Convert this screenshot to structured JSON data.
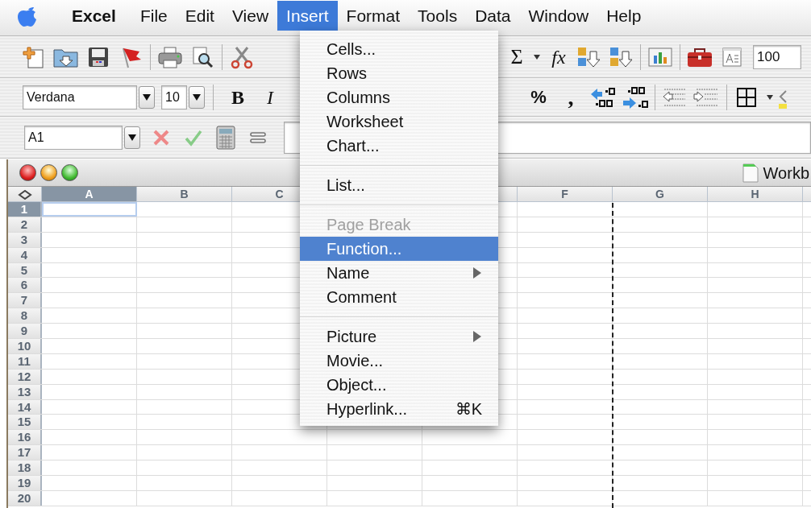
{
  "menubar": {
    "items": [
      {
        "label": "Excel",
        "kind": "app",
        "selected": false
      },
      {
        "label": "File",
        "kind": "menu",
        "selected": false
      },
      {
        "label": "Edit",
        "kind": "menu",
        "selected": false
      },
      {
        "label": "View",
        "kind": "menu",
        "selected": false
      },
      {
        "label": "Insert",
        "kind": "menu",
        "selected": true
      },
      {
        "label": "Format",
        "kind": "menu",
        "selected": false
      },
      {
        "label": "Tools",
        "kind": "menu",
        "selected": false
      },
      {
        "label": "Data",
        "kind": "menu",
        "selected": false
      },
      {
        "label": "Window",
        "kind": "menu",
        "selected": false
      },
      {
        "label": "Help",
        "kind": "menu",
        "selected": false
      }
    ]
  },
  "standard_toolbar": {
    "sum": "Σ",
    "function": "fx",
    "zoom": "100"
  },
  "formatting_toolbar": {
    "font": "Verdana",
    "size": "10",
    "bold": "B",
    "italic": "I",
    "percent": "%",
    "comma": ","
  },
  "formula_bar": {
    "name_box": "A1"
  },
  "workbook": {
    "title": "Workb",
    "columns_left": [
      {
        "label": "A",
        "selected": true,
        "page_break": false
      },
      {
        "label": "B",
        "selected": false,
        "page_break": false
      },
      {
        "label": "C",
        "selected": false,
        "page_break": false
      }
    ],
    "columns_right": [
      {
        "label": "F",
        "selected": false,
        "page_break": true
      },
      {
        "label": "G",
        "selected": false,
        "page_break": false
      },
      {
        "label": "H",
        "selected": false,
        "page_break": false
      }
    ],
    "rows": [
      {
        "label": "1",
        "selected": true
      },
      {
        "label": "2",
        "selected": false
      },
      {
        "label": "3",
        "selected": false
      },
      {
        "label": "4",
        "selected": false
      },
      {
        "label": "5",
        "selected": false
      },
      {
        "label": "6",
        "selected": false
      },
      {
        "label": "7",
        "selected": false
      },
      {
        "label": "8",
        "selected": false
      },
      {
        "label": "9",
        "selected": false
      },
      {
        "label": "10",
        "selected": false
      },
      {
        "label": "11",
        "selected": false
      },
      {
        "label": "12",
        "selected": false
      },
      {
        "label": "13",
        "selected": false
      },
      {
        "label": "14",
        "selected": false
      },
      {
        "label": "15",
        "selected": false
      },
      {
        "label": "16",
        "selected": false
      },
      {
        "label": "17",
        "selected": false
      },
      {
        "label": "18",
        "selected": false
      },
      {
        "label": "19",
        "selected": false
      },
      {
        "label": "20",
        "selected": false
      }
    ]
  },
  "insert_menu": {
    "items": [
      {
        "kind": "item",
        "label": "Cells...",
        "disabled": false,
        "selected": false
      },
      {
        "kind": "item",
        "label": "Rows",
        "disabled": false,
        "selected": false
      },
      {
        "kind": "item",
        "label": "Columns",
        "disabled": false,
        "selected": false
      },
      {
        "kind": "item",
        "label": "Worksheet",
        "disabled": false,
        "selected": false
      },
      {
        "kind": "item",
        "label": "Chart...",
        "disabled": false,
        "selected": false
      },
      {
        "kind": "separator"
      },
      {
        "kind": "item",
        "label": "List...",
        "disabled": false,
        "selected": false
      },
      {
        "kind": "separator"
      },
      {
        "kind": "item",
        "label": "Page Break",
        "disabled": true,
        "selected": false
      },
      {
        "kind": "item",
        "label": "Function...",
        "disabled": false,
        "selected": true
      },
      {
        "kind": "item",
        "label": "Name",
        "disabled": false,
        "selected": false,
        "submenu": true
      },
      {
        "kind": "item",
        "label": "Comment",
        "disabled": false,
        "selected": false
      },
      {
        "kind": "separator"
      },
      {
        "kind": "item",
        "label": "Picture",
        "disabled": false,
        "selected": false,
        "submenu": true
      },
      {
        "kind": "item",
        "label": "Movie...",
        "disabled": false,
        "selected": false
      },
      {
        "kind": "item",
        "label": "Object...",
        "disabled": false,
        "selected": false
      },
      {
        "kind": "item",
        "label": "Hyperlink...",
        "disabled": false,
        "selected": false,
        "shortcut": "⌘K"
      }
    ]
  }
}
